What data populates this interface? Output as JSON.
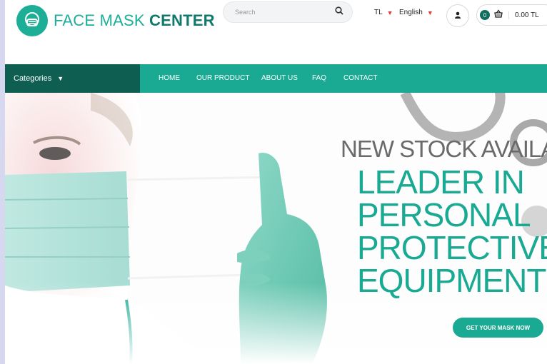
{
  "header": {
    "logo_text_light": "FACE MASK ",
    "logo_text_bold": "CENTER",
    "search_placeholder": "Search",
    "currency": "TL",
    "language": "English",
    "cart_count": "0",
    "cart_total": "0.00 TL"
  },
  "nav": {
    "categories_label": "Categories",
    "links": [
      "HOME",
      "OUR PRODUCT",
      "ABOUT US",
      "FAQ",
      "CONTACT"
    ]
  },
  "hero": {
    "subtitle": "NEW STOCK AVAILABLE",
    "title": "LEADER IN\nPERSONAL\nPROTECTIVE\nEQUIPMENT",
    "cta_label": "GET YOUR MASK NOW"
  },
  "colors": {
    "brand": "#1aa993",
    "brand_dark": "#0e5e51",
    "accent_red": "#e23b3b"
  },
  "icons": [
    "mask-logo-icon",
    "search-icon",
    "chevron-down-icon",
    "user-icon",
    "basket-icon"
  ]
}
